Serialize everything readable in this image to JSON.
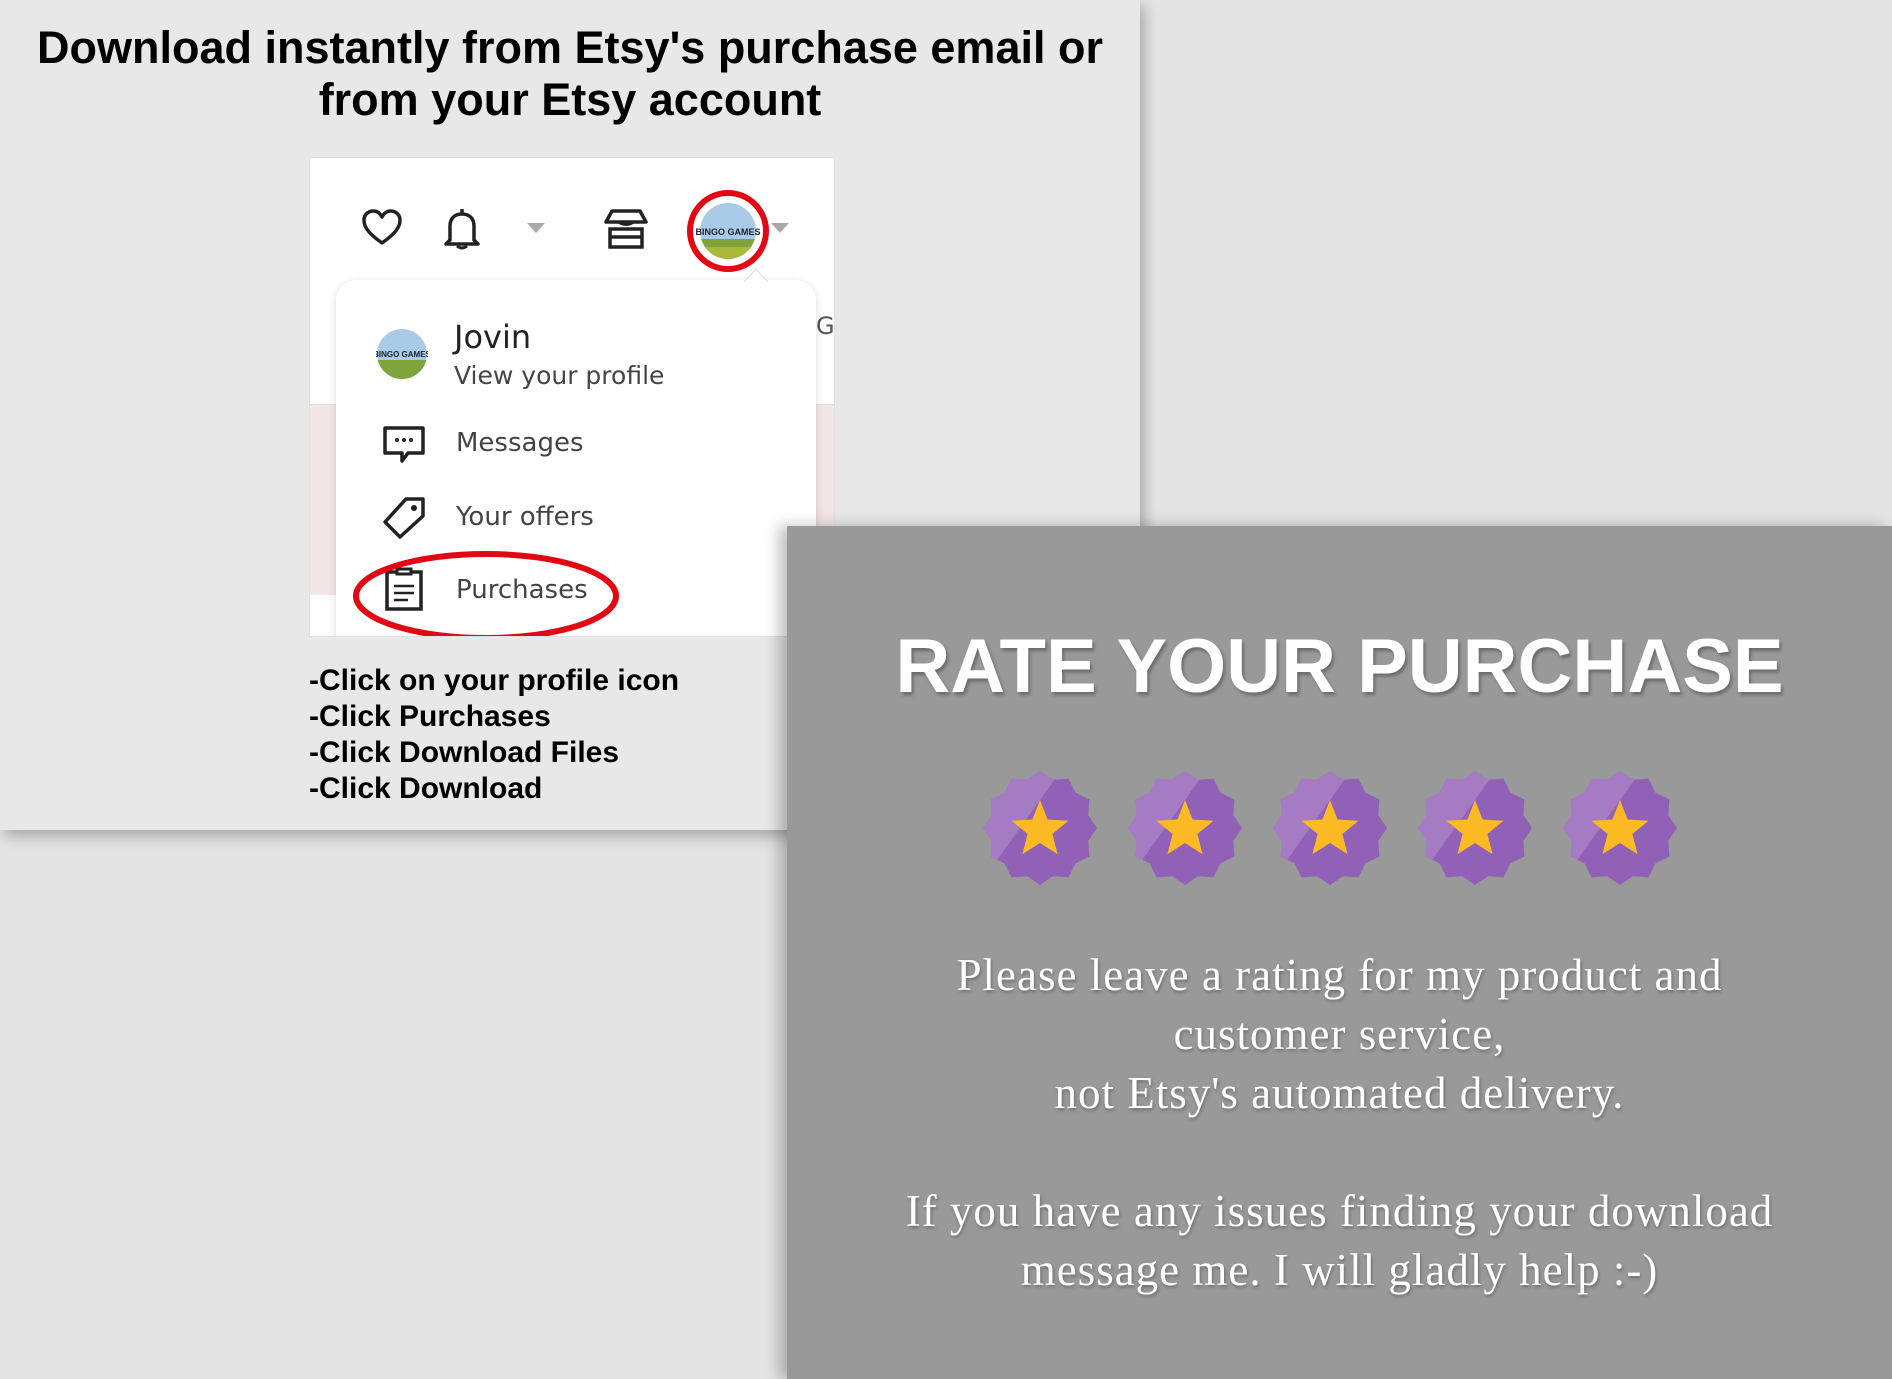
{
  "heading": {
    "line1": "Download instantly from Etsy's purchase email or",
    "line2": "from your Etsy account"
  },
  "etsy_header": {
    "icons": [
      "heart-icon",
      "bell-icon",
      "store-icon",
      "avatar"
    ],
    "avatar_text": "BINGO GAMES",
    "cut_off_text": "G"
  },
  "dropdown": {
    "profile_name": "Jovin",
    "profile_link": "View your profile",
    "items": [
      {
        "label": "Messages",
        "icon": "message-icon"
      },
      {
        "label": "Your offers",
        "icon": "tag-icon"
      },
      {
        "label": "Purchases",
        "icon": "clipboard-icon"
      }
    ]
  },
  "instructions": [
    "-Click on your profile icon",
    "-Click Purchases",
    "-Click Download Files",
    "-Click Download"
  ],
  "rating": {
    "title": "RATE YOUR PURCHASE",
    "stars": 5,
    "max_stars": 5,
    "lines": [
      "Please leave a rating for my product and",
      "customer service,",
      "not Etsy's automated delivery.",
      "",
      "If you have any issues finding your download",
      "message me. I will gladly help :-)"
    ]
  },
  "colors": {
    "highlight": "#e30613",
    "badge_light": "#a57cc4",
    "badge_dark": "#9160b7",
    "star": "#fbb924",
    "panel": "#999999"
  }
}
